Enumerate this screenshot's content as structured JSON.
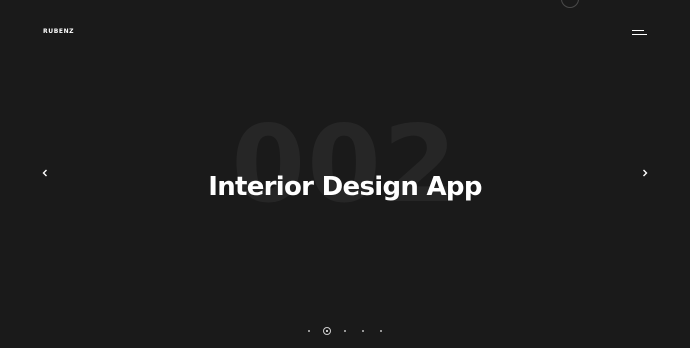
{
  "header": {
    "logo_text": "RUBENZ",
    "menu_icon": "hamburger-menu-icon"
  },
  "slider": {
    "background_number": "002",
    "title": "Interior Design App",
    "prev_icon": "chevron-left-icon",
    "next_icon": "chevron-right-icon",
    "total_slides": 5,
    "active_slide": 2
  },
  "colors": {
    "background": "#1a1a1a",
    "background_number": "#262626",
    "text": "#ffffff"
  }
}
